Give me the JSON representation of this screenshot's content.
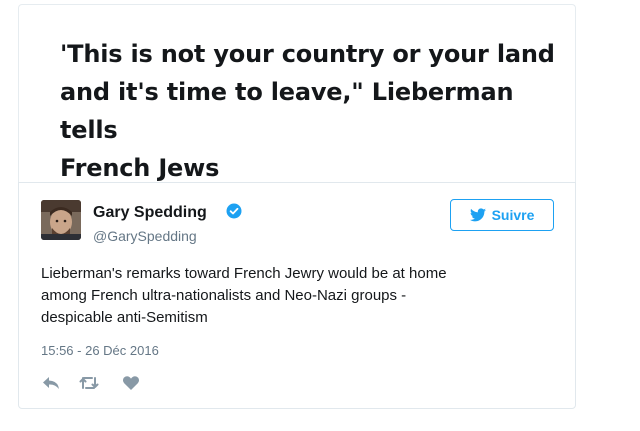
{
  "headline": {
    "lines": [
      "'This is not your country or your land",
      "and it's time to leave,\" Lieberman tells",
      "French Jews"
    ]
  },
  "tweet": {
    "author_name": "Gary Spedding",
    "author_handle": "@GarySpedding",
    "verified": true,
    "follow_label": "Suivre",
    "text_lines": [
      "Lieberman's remarks toward French Jewry would be at home",
      "among French ultra-nationalists and Neo-Nazi groups -",
      "despicable anti-Semitism"
    ],
    "timestamp": "15:56 - 26 Déc 2016",
    "actions": [
      "reply-icon",
      "retweet-icon",
      "like-icon"
    ]
  },
  "colors": {
    "twitter_blue": "#1da1f2",
    "text_primary": "#14171a",
    "text_secondary": "#657786",
    "action_gray": "#8899a6",
    "border": "#e1e8ed"
  }
}
